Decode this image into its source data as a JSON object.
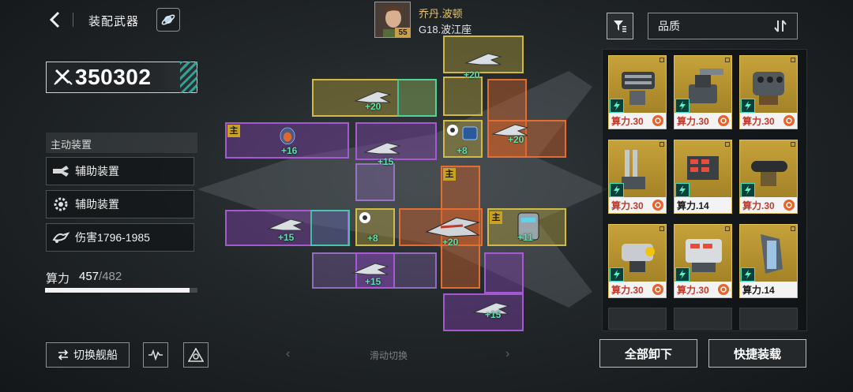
{
  "header": {
    "title": "装配武器",
    "pilot": {
      "name": "乔丹.波顿",
      "ship": "G18.波江座",
      "level": "55"
    }
  },
  "sort": {
    "selected": "品质"
  },
  "left": {
    "power": "350302",
    "section_label": "主动装置",
    "items": [
      {
        "label": "辅助装置",
        "icon": "drone-icon"
      },
      {
        "label": "辅助装置",
        "icon": "gear-icon"
      },
      {
        "label": "伤害1796-1985",
        "icon": "damage-icon"
      }
    ],
    "compute": {
      "label": "算力",
      "used": "457",
      "total": "/482",
      "fraction": 0.948
    },
    "switch_ship_label": "切换舰船"
  },
  "grid": {
    "main_tag": "主",
    "bonuses": [
      "+20",
      "+20",
      "+16",
      "+15",
      "+8",
      "+20",
      "+15",
      "+8",
      "+20",
      "+11",
      "+15",
      "+15"
    ],
    "swipe_hint": "滑动切换"
  },
  "inventory": {
    "cards": [
      {
        "cost": "算力.30",
        "art": "gatling"
      },
      {
        "cost": "算力.30",
        "art": "turret"
      },
      {
        "cost": "算力.30",
        "art": "rocket-pod"
      },
      {
        "cost": "算力.30",
        "art": "twin-cannon"
      },
      {
        "cost": "算力.14",
        "art": "missile-rack"
      },
      {
        "cost": "算力.30",
        "art": "heavy-barrel"
      },
      {
        "cost": "算力.30",
        "art": "pulse-cannon"
      },
      {
        "cost": "算力.30",
        "art": "drone-bay"
      },
      {
        "cost": "算力.14",
        "art": "rail-gun"
      }
    ],
    "unequip_all": "全部卸下",
    "quick_equip": "快捷装载"
  },
  "colors": {
    "accent_teal": "#2fb9a9",
    "yellow_slot": "#d6be46",
    "purple_slot": "#aa5cd6",
    "orange_slot": "#e87032",
    "bonus_green": "#5ee3ae",
    "card_gold": "#c6a23a"
  }
}
